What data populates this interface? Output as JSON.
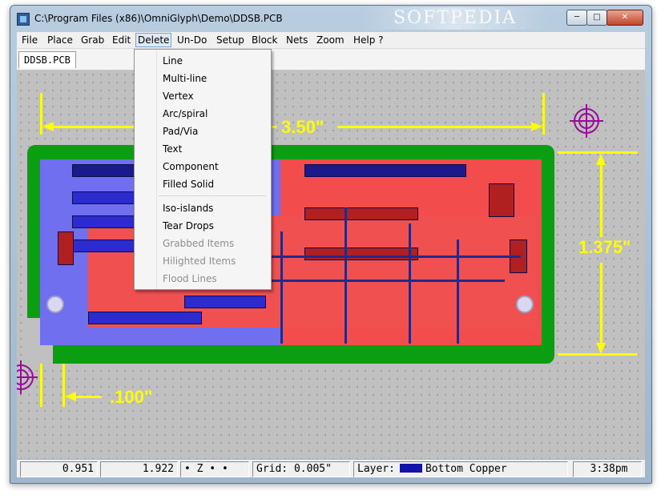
{
  "window": {
    "title": "C:\\Program Files (x86)\\OmniGlyph\\Demo\\DDSB.PCB",
    "watermark": "SOFTPEDIA",
    "minimize_label": "─",
    "maximize_label": "□",
    "close_label": "✕"
  },
  "menubar": {
    "items": [
      {
        "label": "File"
      },
      {
        "label": "Place"
      },
      {
        "label": "Grab"
      },
      {
        "label": "Edit"
      },
      {
        "label": "Delete"
      },
      {
        "label": "Un-Do"
      },
      {
        "label": "Setup"
      },
      {
        "label": "Block"
      },
      {
        "label": "Nets"
      },
      {
        "label": "Zoom"
      },
      {
        "label": "Help ?"
      }
    ],
    "active": "Delete"
  },
  "tabs": [
    {
      "label": "DDSB.PCB"
    }
  ],
  "delete_menu": {
    "items": [
      {
        "label": "Line",
        "enabled": true
      },
      {
        "label": "Multi-line",
        "enabled": true
      },
      {
        "label": "Vertex",
        "enabled": true
      },
      {
        "label": "Arc/spiral",
        "enabled": true
      },
      {
        "label": "Pad/Via",
        "enabled": true
      },
      {
        "label": "Text",
        "enabled": true
      },
      {
        "label": "Component",
        "enabled": true
      },
      {
        "label": "Filled Solid",
        "enabled": true
      },
      {
        "label": "Iso-islands",
        "enabled": true
      },
      {
        "label": "Tear Drops",
        "enabled": true
      },
      {
        "label": "Grabbed Items",
        "enabled": false
      },
      {
        "label": "Hilighted Items",
        "enabled": false
      },
      {
        "label": "Flood Lines",
        "enabled": false
      }
    ]
  },
  "canvas": {
    "width_dimension": "3.50\"",
    "height_dimension": "1.375\"",
    "offset_dimension": ".100\"",
    "colors": {
      "background": "#c0c0c0",
      "board_outline": "#0a9e10",
      "top_copper": "#f24c4c",
      "bottom_copper": "#6f6ff0",
      "dimension": "#ffff00",
      "target": "#9a0a9a"
    }
  },
  "statusbar": {
    "x_coord": "0.951",
    "y_coord": "1.922",
    "snap": "• Z • •",
    "grid": "Grid: 0.005\"",
    "layer_label": "Layer:",
    "layer_name": "Bottom Copper",
    "layer_color": "#1212a8",
    "time": "3:38pm"
  }
}
